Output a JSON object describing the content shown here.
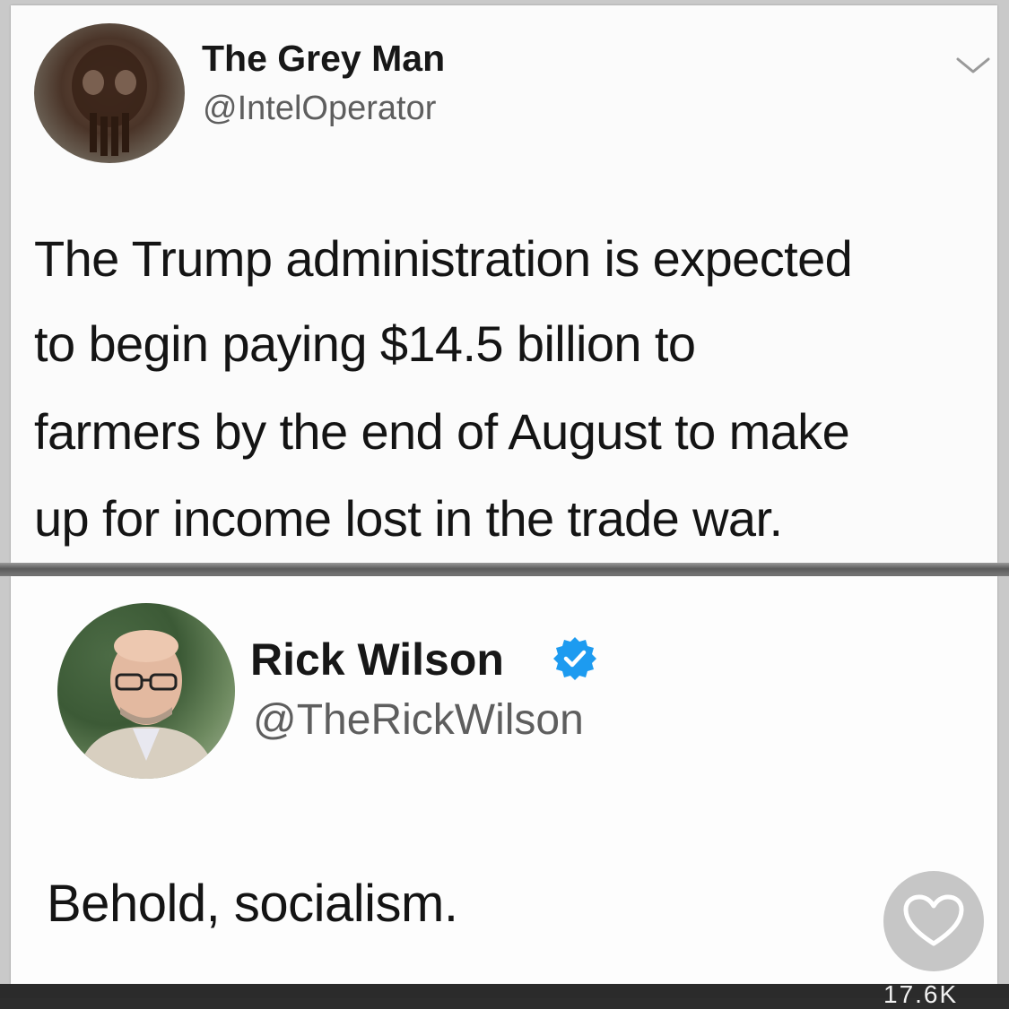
{
  "tweets": [
    {
      "author_name": "The Grey Man",
      "author_handle": "@IntelOperator",
      "avatar": "punisher-skull-avatar",
      "text_lines": [
        "The Trump administration is expected",
        "to begin paying $14.5 billion to",
        "farmers by the end of August to make",
        "up for income lost in the trade war."
      ],
      "menu_icon": "chevron-down-icon"
    },
    {
      "author_name": "Rick Wilson",
      "author_handle": "@TheRickWilson",
      "verified": true,
      "avatar": "profile-photo-avatar",
      "text": "Behold, socialism."
    }
  ],
  "like": {
    "icon": "heart-icon",
    "count": "17.6K"
  },
  "colors": {
    "verified_blue": "#1d9bf0",
    "handle_grey": "#5e5e5e",
    "text_dark": "#141414"
  }
}
